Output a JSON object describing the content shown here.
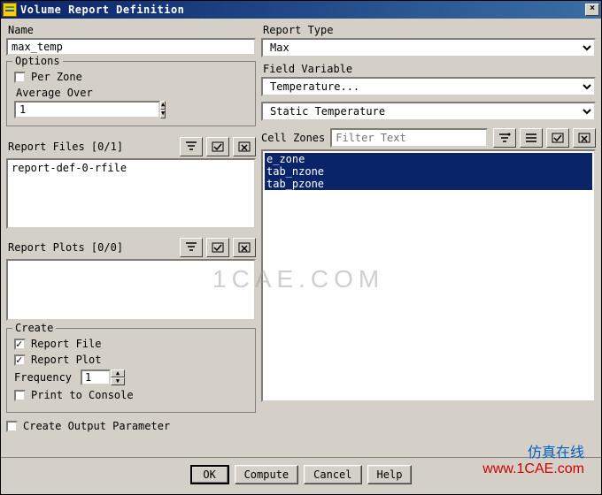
{
  "title": "Volume Report Definition",
  "left": {
    "name_label": "Name",
    "name_value": "max_temp",
    "options_legend": "Options",
    "per_zone_label": "Per Zone",
    "per_zone_checked": false,
    "average_over_label": "Average Over",
    "average_over_value": "1",
    "report_files_label": "Report Files [0/1]",
    "report_files_items": [
      "report-def-0-rfile"
    ],
    "report_plots_label": "Report Plots [0/0]",
    "create_legend": "Create",
    "report_file_label": "Report File",
    "report_file_checked": true,
    "report_plot_label": "Report Plot",
    "report_plot_checked": true,
    "frequency_label": "Frequency",
    "frequency_value": "1",
    "print_to_console_label": "Print to Console",
    "print_to_console_checked": false,
    "create_output_parameter_label": "Create Output Parameter",
    "create_output_parameter_checked": false
  },
  "right": {
    "report_type_label": "Report Type",
    "report_type_value": "Max",
    "field_variable_label": "Field Variable",
    "field_variable_value1": "Temperature...",
    "field_variable_value2": "Static Temperature",
    "cell_zones_label": "Cell Zones",
    "cell_zones_filter_placeholder": "Filter Text",
    "cell_zones_items": [
      "e_zone",
      "tab_nzone",
      "tab_pzone"
    ]
  },
  "buttons": {
    "ok": "OK",
    "compute": "Compute",
    "cancel": "Cancel",
    "help": "Help"
  },
  "watermark": {
    "big": "1CAE.COM",
    "line1": "仿真在线",
    "line2": "www.1CAE.com"
  }
}
